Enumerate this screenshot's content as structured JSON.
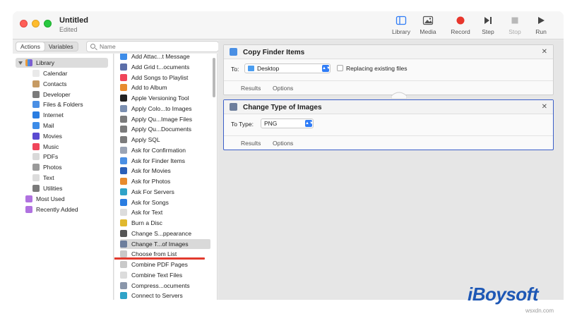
{
  "window": {
    "title": "Untitled",
    "subtitle": "Edited"
  },
  "toolbar": [
    {
      "label": "Library",
      "icon": "sidebar-icon",
      "disabled": false
    },
    {
      "label": "Media",
      "icon": "photo-icon",
      "disabled": false
    },
    {
      "label": "Record",
      "icon": "record-icon",
      "disabled": false
    },
    {
      "label": "Step",
      "icon": "step-icon",
      "disabled": false
    },
    {
      "label": "Stop",
      "icon": "stop-icon",
      "disabled": true
    },
    {
      "label": "Run",
      "icon": "play-icon",
      "disabled": false
    }
  ],
  "tabs": {
    "actions": "Actions",
    "variables": "Variables"
  },
  "search": {
    "placeholder": "Name",
    "value": ""
  },
  "library": {
    "root": "Library",
    "items": [
      {
        "label": "Calendar",
        "color": "#e9e9e9"
      },
      {
        "label": "Contacts",
        "color": "#c69a63"
      },
      {
        "label": "Developer",
        "color": "#7b7b7b"
      },
      {
        "label": "Files & Folders",
        "color": "#4a8fe4"
      },
      {
        "label": "Internet",
        "color": "#2a7de1"
      },
      {
        "label": "Mail",
        "color": "#3d8ce8"
      },
      {
        "label": "Movies",
        "color": "#5b4bd1"
      },
      {
        "label": "Music",
        "color": "#f0455a"
      },
      {
        "label": "PDFs",
        "color": "#d9d9d9"
      },
      {
        "label": "Photos",
        "color": "#9a9a9a"
      },
      {
        "label": "Text",
        "color": "#dcdcdc"
      },
      {
        "label": "Utilities",
        "color": "#7a7a7a"
      }
    ],
    "smart": [
      {
        "label": "Most Used",
        "color": "#b072e0"
      },
      {
        "label": "Recently Added",
        "color": "#b072e0"
      }
    ]
  },
  "actions": [
    {
      "label": "Add Attac...t Message",
      "color": "#3d8ce8"
    },
    {
      "label": "Add Grid t...ocuments",
      "color": "#5c6ea8"
    },
    {
      "label": "Add Songs to Playlist",
      "color": "#f0455a"
    },
    {
      "label": "Add to Album",
      "color": "#e88b2e"
    },
    {
      "label": "Apple Versioning Tool",
      "color": "#222222"
    },
    {
      "label": "Apply Colo...to Images",
      "color": "#7b8fb0"
    },
    {
      "label": "Apply Qu...Image Files",
      "color": "#7b7b7b"
    },
    {
      "label": "Apply Qu...Documents",
      "color": "#7b7b7b"
    },
    {
      "label": "Apply SQL",
      "color": "#7b7b7b"
    },
    {
      "label": "Ask for Confirmation",
      "color": "#9aa4b5"
    },
    {
      "label": "Ask for Finder Items",
      "color": "#4a8fe4"
    },
    {
      "label": "Ask for Movies",
      "color": "#2a5fb8"
    },
    {
      "label": "Ask for Photos",
      "color": "#e88b2e"
    },
    {
      "label": "Ask For Servers",
      "color": "#2fa3c8"
    },
    {
      "label": "Ask for Songs",
      "color": "#2a7de1"
    },
    {
      "label": "Ask for Text",
      "color": "#dcdcdc"
    },
    {
      "label": "Burn a Disc",
      "color": "#e0b82e"
    },
    {
      "label": "Change S...ppearance",
      "color": "#555555"
    },
    {
      "label": "Change T...of Images",
      "color": "#6d7e9c",
      "selected": true
    },
    {
      "label": "Choose from List",
      "color": "#c9c9c9"
    },
    {
      "label": "Combine PDF Pages",
      "color": "#c9c9c9"
    },
    {
      "label": "Combine Text Files",
      "color": "#dcdcdc"
    },
    {
      "label": "Compress...ocuments",
      "color": "#8a96aa"
    },
    {
      "label": "Connect to Servers",
      "color": "#2fa3c8"
    }
  ],
  "workflow": [
    {
      "title": "Copy Finder Items",
      "icon_color": "#4a8fe4",
      "field_label": "To:",
      "popup_value": "Desktop",
      "checkbox_label": "Replacing existing files",
      "results": "Results",
      "options": "Options",
      "selected": false
    },
    {
      "title": "Change Type of Images",
      "icon_color": "#6d7e9c",
      "field_label": "To Type:",
      "popup_value": "PNG",
      "results": "Results",
      "options": "Options",
      "selected": true
    }
  ],
  "branding": {
    "logo": "iBoysoft",
    "watermark": "wsxdn.com"
  }
}
